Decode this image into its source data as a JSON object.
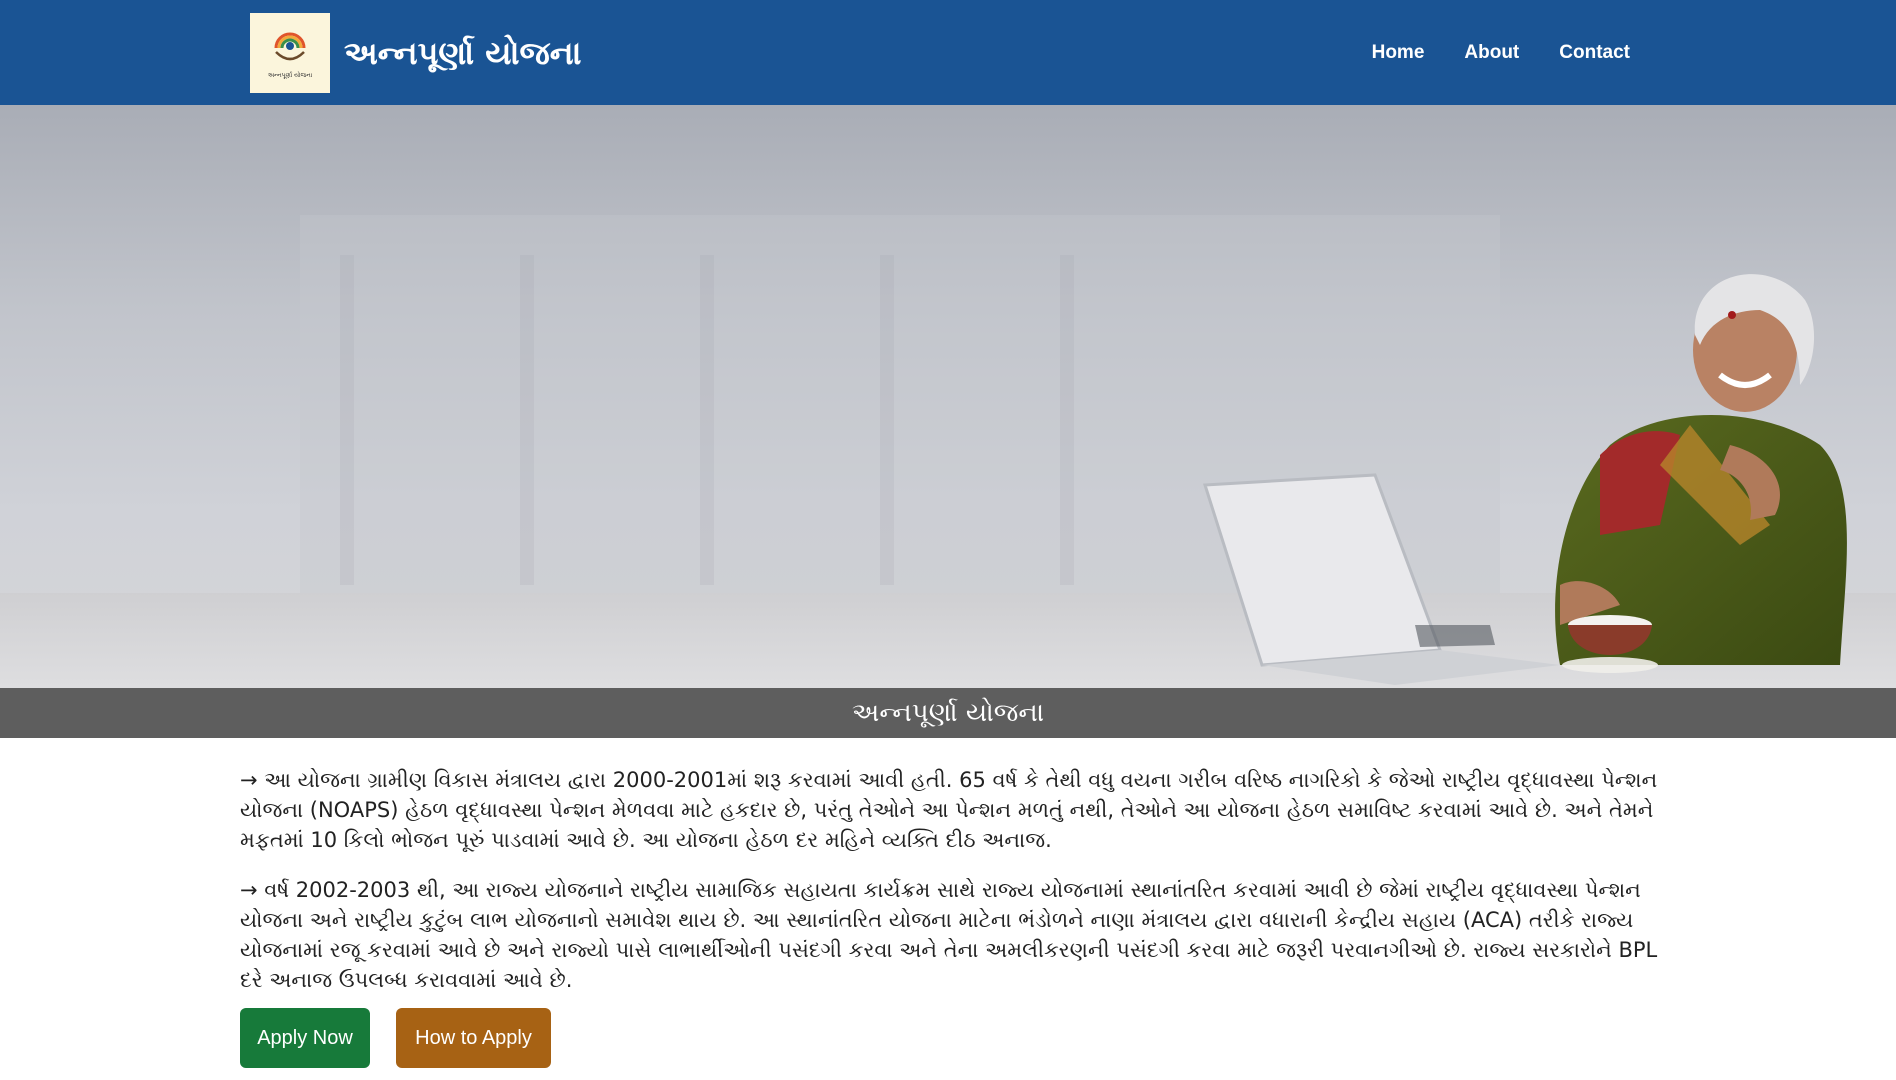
{
  "header": {
    "brand_title": "અન્નપૂર્ણા યોજના",
    "logo_caption": "અન્નપૂર્ણા યોજના",
    "nav": [
      {
        "label": "Home"
      },
      {
        "label": "About"
      },
      {
        "label": "Contact"
      }
    ]
  },
  "hero": {
    "caption": "અન્નપૂર્ણા યોજના"
  },
  "content": {
    "paragraphs": [
      "→ આ યોજના ગ્રામીણ વિકાસ મંત્રાલય દ્વારા 2000-2001માં શરૂ કરવામાં આવી હતી. 65 વર્ષ કે તેથી વધુ વયના ગરીબ વરિષ્ઠ નાગરિકો કે જેઓ રાષ્ટ્રીય વૃદ્ધાવસ્થા પેન્શન યોજના (NOAPS) હેઠળ વૃદ્ધાવસ્થા પેન્શન મેળવવા માટે હકદાર છે, પરંતુ તેઓને આ પેન્શન મળતું નથી, તેઓને આ યોજના હેઠળ સમાવિષ્ટ કરવામાં આવે છે. અને તેમને મફતમાં 10 કિલો ભોજન પૂરું પાડવામાં આવે છે. આ યોજના હેઠળ દર મહિને વ્યક્તિ દીઠ અનાજ.",
      "→ વર્ષ 2002-2003 થી, આ રાજ્ય યોજનાને રાષ્ટ્રીય સામાજિક સહાયતા કાર્યક્રમ સાથે રાજ્ય યોજનામાં સ્થાનાંતરિત કરવામાં આવી છે જેમાં રાષ્ટ્રીય વૃદ્ધાવસ્થા પેન્શન યોજના અને રાષ્ટ્રીય કુટુંબ લાભ યોજનાનો સમાવેશ થાય છે. આ સ્થાનાંતરિત યોજના માટેના ભંડોળને નાણા મંત્રાલય દ્વારા વધારાની કેન્દ્રીય સહાય (ACA) તરીકે રાજ્ય યોજનામાં રજૂ કરવામાં આવે છે અને રાજ્યો પાસે લાભાર્થીઓની પસંદગી કરવા અને તેના અમલીકરણની પસંદગી કરવા માટે જરૂરી પરવાનગીઓ છે. રાજ્ય સરકારોને BPL દરે અનાજ ઉપલબ્ધ કરાવવામાં આવે છે."
    ]
  },
  "buttons": {
    "apply_now": "Apply Now",
    "how_to_apply": "How to Apply"
  },
  "colors": {
    "header_bg": "#1a5494",
    "caption_bar_bg": "#5e5e5e",
    "apply_button": "#177a3a",
    "how_button": "#a76214"
  }
}
